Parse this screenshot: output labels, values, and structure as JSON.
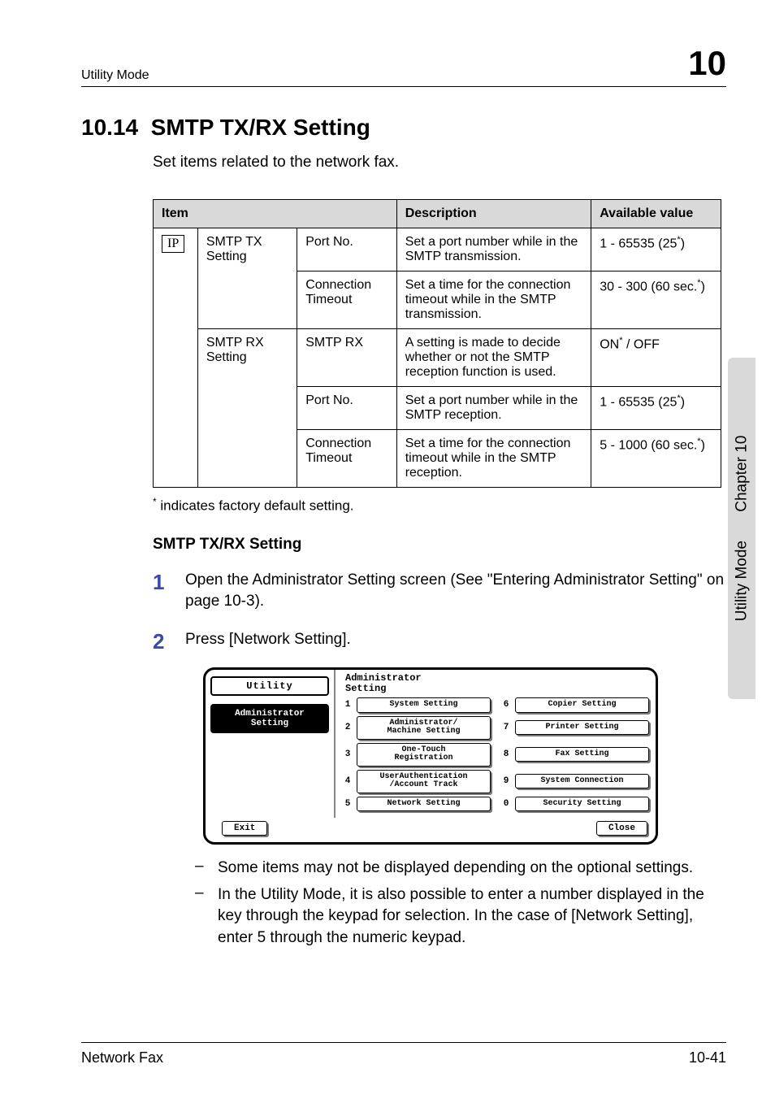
{
  "header": {
    "section": "Utility Mode",
    "chapter_num": "10"
  },
  "title": {
    "num": "10.14",
    "text": "SMTP TX/RX Setting"
  },
  "intro": "Set items related to the network fax.",
  "table": {
    "headers": {
      "item": "Item",
      "desc": "Description",
      "avail": "Available value"
    },
    "ip_tag": "IP",
    "group1": "SMTP TX Setting",
    "group2": "SMTP RX Setting",
    "rows": [
      {
        "sub": "Port No.",
        "desc": "Set a port number while in the SMTP transmission.",
        "avail_pre": "1 - 65535 (25",
        "avail_post": ")"
      },
      {
        "sub": "Connection Timeout",
        "desc": "Set a time for the connection timeout while in the SMTP transmission.",
        "avail_pre": "30 - 300 (60 sec.",
        "avail_post": ")"
      },
      {
        "sub": "SMTP RX",
        "desc": "A setting is made to decide whether or not the SMTP reception function is used.",
        "avail_pre": "ON",
        "avail_post": " / OFF"
      },
      {
        "sub": "Port No.",
        "desc": "Set a port number while in the SMTP reception.",
        "avail_pre": "1 - 65535 (25",
        "avail_post": ")"
      },
      {
        "sub": "Connection Timeout",
        "desc": "Set a time for the connection timeout while in the SMTP reception.",
        "avail_pre": "5 - 1000 (60 sec.",
        "avail_post": ")"
      }
    ]
  },
  "footnote": " indicates factory default setting.",
  "subhead": "SMTP TX/RX Setting",
  "steps": {
    "s1": {
      "num": "1",
      "text": "Open the Administrator Setting screen (See \"Entering Administrator Setting\" on page 10-3)."
    },
    "s2": {
      "num": "2",
      "text": "Press [Network Setting]."
    }
  },
  "screenshot": {
    "utility": "Utility",
    "admin": "Administrator\nSetting",
    "right_title": "Administrator\nSetting",
    "buttons": [
      {
        "n": "1",
        "label": "System Setting"
      },
      {
        "n": "6",
        "label": "Copier Setting"
      },
      {
        "n": "2",
        "label": "Administrator/\nMachine Setting"
      },
      {
        "n": "7",
        "label": "Printer Setting"
      },
      {
        "n": "3",
        "label": "One-Touch\nRegistration"
      },
      {
        "n": "8",
        "label": "Fax Setting"
      },
      {
        "n": "4",
        "label": "UserAuthentication\n/Account Track"
      },
      {
        "n": "9",
        "label": "System Connection"
      },
      {
        "n": "5",
        "label": "Network Setting"
      },
      {
        "n": "0",
        "label": "Security Setting"
      }
    ],
    "exit": "Exit",
    "close": "Close"
  },
  "bullets": {
    "b1": "Some items may not be displayed depending on the optional settings.",
    "b2": "In the Utility Mode, it is also possible to enter a number displayed in the key through the keypad for selection. In the case of [Network Setting], enter 5 through the numeric keypad."
  },
  "sidebar": {
    "util": "Utility Mode",
    "chapter": "Chapter 10"
  },
  "footer": {
    "left": "Network Fax",
    "right": "10-41"
  }
}
